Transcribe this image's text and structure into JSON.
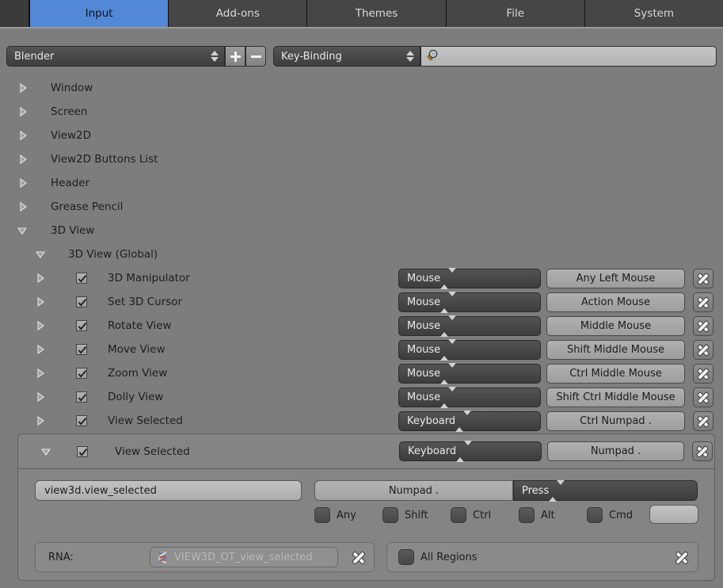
{
  "tabs": [
    {
      "label": "Input",
      "selected": true
    },
    {
      "label": "Add-ons",
      "selected": false
    },
    {
      "label": "Themes",
      "selected": false
    },
    {
      "label": "File",
      "selected": false
    },
    {
      "label": "System",
      "selected": false
    }
  ],
  "header": {
    "preset_value": "Blender",
    "add_preset_icon": "plus-icon",
    "remove_preset_icon": "minus-icon",
    "filter_type_value": "Key-Binding",
    "search_icon": "magnifier-icon",
    "search_value": "",
    "search_placeholder": ""
  },
  "tree": [
    {
      "label": "Window",
      "indent": 0,
      "expanded": false,
      "checkbox": null
    },
    {
      "label": "Screen",
      "indent": 0,
      "expanded": false,
      "checkbox": null
    },
    {
      "label": "View2D",
      "indent": 0,
      "expanded": false,
      "checkbox": null
    },
    {
      "label": "View2D Buttons List",
      "indent": 0,
      "expanded": false,
      "checkbox": null
    },
    {
      "label": "Header",
      "indent": 0,
      "expanded": false,
      "checkbox": null
    },
    {
      "label": "Grease Pencil",
      "indent": 0,
      "expanded": false,
      "checkbox": null
    },
    {
      "label": "3D View",
      "indent": 0,
      "expanded": true,
      "checkbox": null
    },
    {
      "label": "3D View (Global)",
      "indent": 1,
      "expanded": true,
      "checkbox": null
    }
  ],
  "keymap_items": [
    {
      "label": "3D Manipulator",
      "checked": true,
      "map_type": "Mouse",
      "binding": "Any Left Mouse",
      "remove_icon": "x-icon"
    },
    {
      "label": "Set 3D Cursor",
      "checked": true,
      "map_type": "Mouse",
      "binding": "Action Mouse",
      "remove_icon": "x-icon"
    },
    {
      "label": "Rotate View",
      "checked": true,
      "map_type": "Mouse",
      "binding": "Middle Mouse",
      "remove_icon": "x-icon"
    },
    {
      "label": "Move View",
      "checked": true,
      "map_type": "Mouse",
      "binding": "Shift Middle Mouse",
      "remove_icon": "x-icon"
    },
    {
      "label": "Zoom View",
      "checked": true,
      "map_type": "Mouse",
      "binding": "Ctrl Middle Mouse",
      "remove_icon": "x-icon"
    },
    {
      "label": "Dolly View",
      "checked": true,
      "map_type": "Mouse",
      "binding": "Shift Ctrl Middle Mouse",
      "remove_icon": "x-icon"
    },
    {
      "label": "View Selected",
      "checked": true,
      "map_type": "Keyboard",
      "binding": "Ctrl Numpad .",
      "remove_icon": "x-icon"
    }
  ],
  "detail": {
    "title": "View Selected",
    "checked": true,
    "expanded": true,
    "map_type": "Keyboard",
    "binding": "Numpad .",
    "remove_icon": "x-icon",
    "operator_id": "view3d.view_selected",
    "key_name": "Numpad .",
    "event_value": "Press",
    "modifiers": [
      {
        "label": "Any",
        "active": false
      },
      {
        "label": "Shift",
        "active": false
      },
      {
        "label": "Ctrl",
        "active": false
      },
      {
        "label": "Alt",
        "active": false
      },
      {
        "label": "Cmd",
        "active": false
      }
    ],
    "key_modifier_value": "",
    "rna_label": "RNA:",
    "rna_value": "VIEW3D_OT_view_selected",
    "rna_icon": "dna-icon",
    "rna_clear_icon": "x-icon",
    "region_label": "All Regions",
    "region_active": false,
    "region_clear_icon": "x-icon"
  },
  "colors": {
    "accent": "#5288d6",
    "background": "#7d7d7d",
    "tabbar": "#3b3b3b",
    "panel": "#848484"
  }
}
